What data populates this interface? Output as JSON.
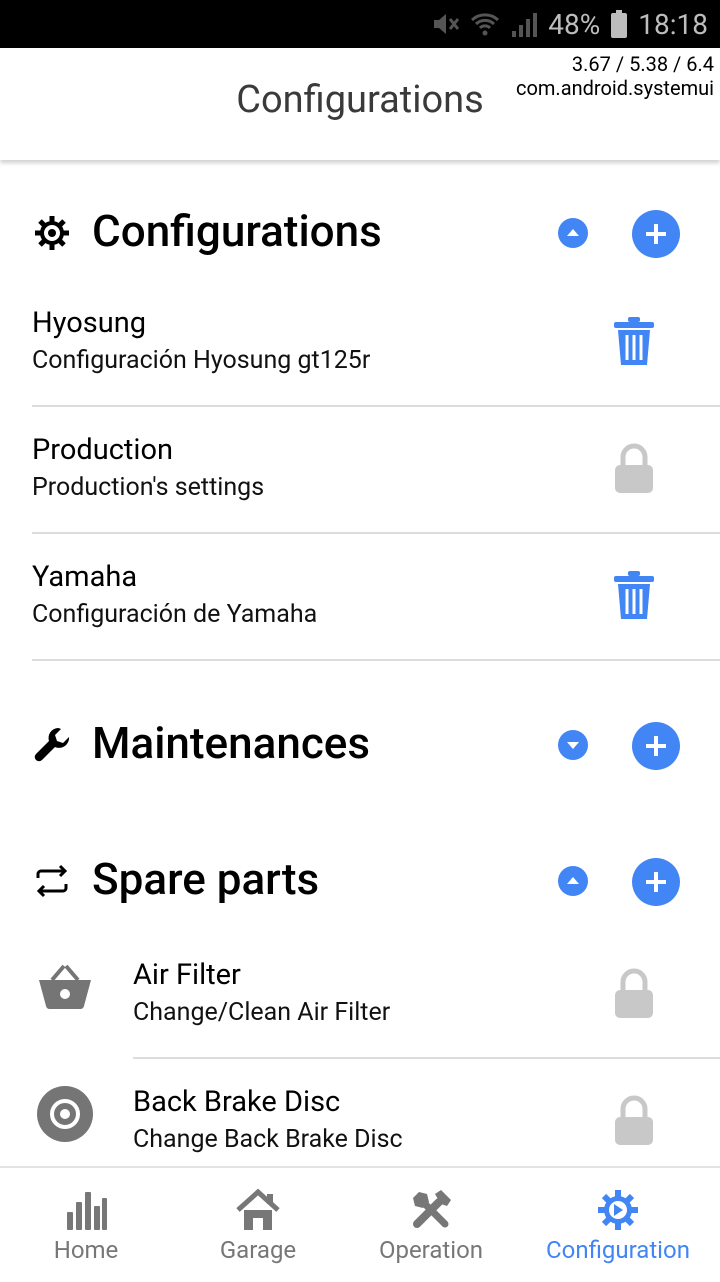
{
  "status_bar": {
    "battery": "48%",
    "time": "18:18"
  },
  "debug_overlay": {
    "line1": "3.67 / 5.38 / 6.4",
    "line2": "com.android.systemui"
  },
  "app_bar": {
    "title": "Configurations"
  },
  "sections": {
    "configurations": {
      "title": "Configurations",
      "items": [
        {
          "title": "Hyosung",
          "subtitle": "Configuración Hyosung gt125r",
          "action": "trash-icon"
        },
        {
          "title": "Production",
          "subtitle": "Production's settings",
          "action": "lock-icon"
        },
        {
          "title": "Yamaha",
          "subtitle": "Configuración de Yamaha",
          "action": "trash-icon"
        }
      ]
    },
    "maintenances": {
      "title": "Maintenances"
    },
    "spare_parts": {
      "title": "Spare parts",
      "items": [
        {
          "title": "Air Filter",
          "subtitle": "Change/Clean Air Filter",
          "icon": "basket-icon",
          "action": "lock-icon"
        },
        {
          "title": "Back Brake Disc",
          "subtitle": "Change Back Brake Disc",
          "icon": "disc-icon",
          "action": "lock-icon"
        }
      ]
    }
  },
  "bottom_nav": {
    "items": [
      {
        "label": "Home",
        "icon": "bar-chart-icon"
      },
      {
        "label": "Garage",
        "icon": "house-icon"
      },
      {
        "label": "Operation",
        "icon": "tools-icon"
      },
      {
        "label": "Configuration",
        "icon": "gear-icon",
        "active": true
      }
    ]
  },
  "colors": {
    "accent": "#4285f4",
    "lock_gray": "#c8c8c8",
    "nav_inactive": "#777777"
  }
}
